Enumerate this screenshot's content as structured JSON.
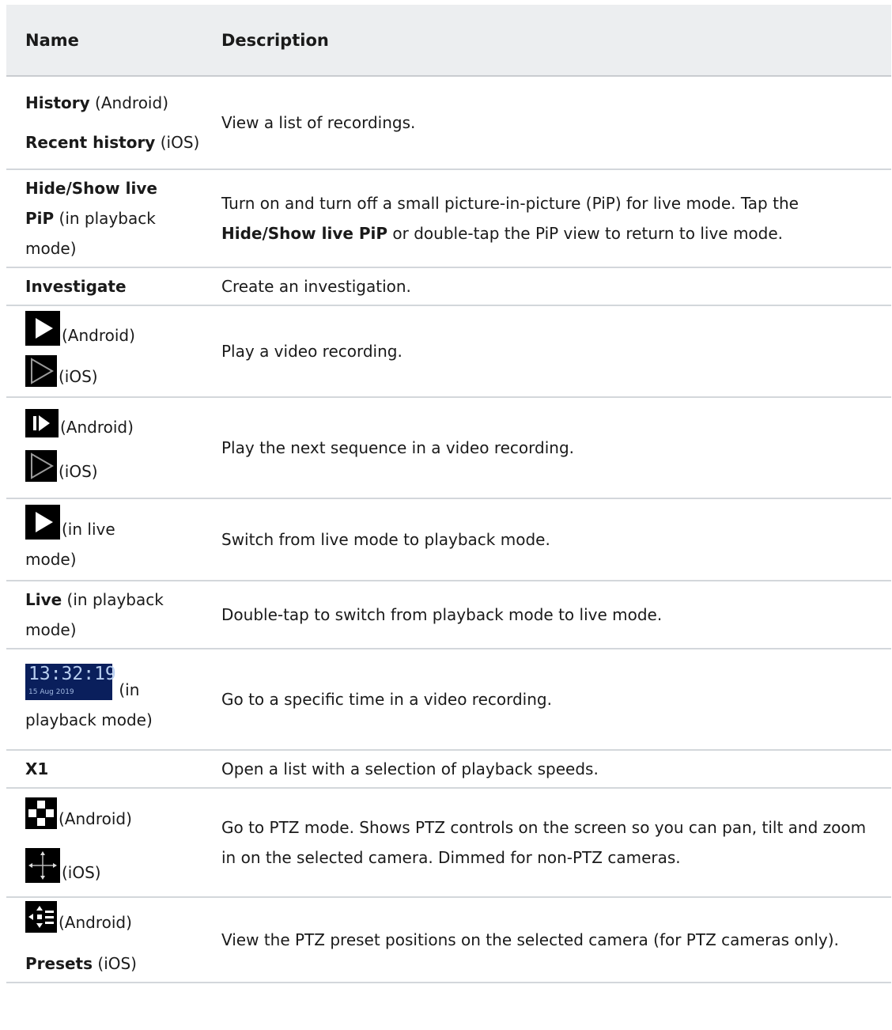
{
  "header": {
    "col_name": "Name",
    "col_description": "Description"
  },
  "rows": {
    "r1": {
      "a_bold": "History",
      "a_rest": " (Android)",
      "b_bold": "Recent history",
      "b_rest": " (iOS)",
      "desc": "View a list of recordings."
    },
    "r2": {
      "bold": "Hide/Show live PiP",
      "rest": " (in playback mode)",
      "desc_pre": "Turn on and turn off a small picture-in-picture (PiP) for live mode. Tap the ",
      "desc_bold": "Hide/Show live PiP",
      "desc_post": " or double-tap the PiP view to return to live mode."
    },
    "r3": {
      "bold": "Investigate",
      "desc": "Create an investigation."
    },
    "r4": {
      "a_label": "(Android)",
      "b_label": "(iOS)",
      "icon_a": "play-filled-icon",
      "icon_b": "play-outline-icon",
      "desc": "Play a video recording."
    },
    "r5": {
      "a_label": "(Android)",
      "b_label": "(iOS)",
      "icon_a": "next-sequence-icon",
      "icon_b": "play-outline-icon",
      "desc": "Play the next sequence in a video recording."
    },
    "r6": {
      "label": "(in live mode)",
      "icon": "play-filled-icon",
      "desc": "Switch from live mode to playback mode."
    },
    "r7": {
      "bold": "Live",
      "rest": " (in playback mode)",
      "desc": "Double-tap to switch from playback mode to live mode."
    },
    "r8": {
      "clock_time": "13:32:19",
      "clock_date": "15 Aug 2019",
      "label": " (in playback mode)",
      "desc": "Go to a specific time in a video recording."
    },
    "r9": {
      "bold": "X1",
      "desc": "Open a list with a selection of playback speeds."
    },
    "r10": {
      "a_label": "(Android)",
      "b_label": "(iOS)",
      "icon_a": "ptz-joystick-icon",
      "icon_b": "ptz-arrows-icon",
      "desc": "Go to PTZ mode. Shows PTZ controls on the screen so you can pan, tilt and zoom in on the selected camera. Dimmed for non-PTZ cameras."
    },
    "r11": {
      "a_label": "(Android)",
      "b_bold": "Presets",
      "b_rest": " (iOS)",
      "icon_a": "presets-icon",
      "desc": "View the PTZ preset positions on the selected camera (for PTZ cameras only)."
    }
  }
}
